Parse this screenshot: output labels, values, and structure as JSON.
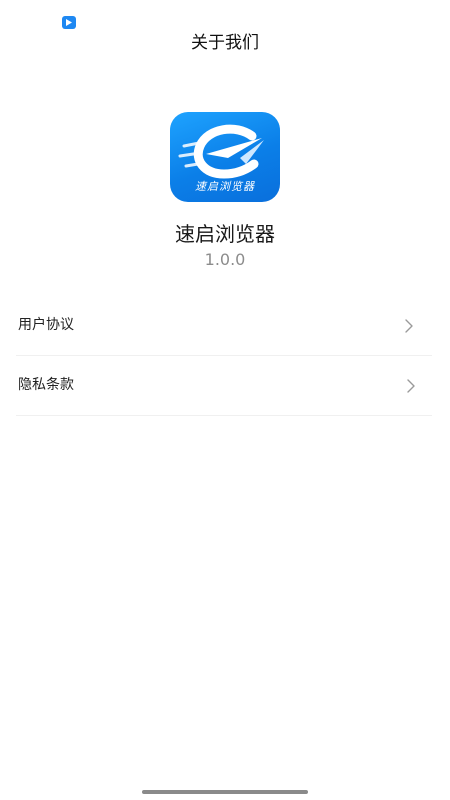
{
  "status_bar": {
    "icon": "app-notification-icon"
  },
  "header": {
    "title": "关于我们"
  },
  "app": {
    "logo_icon": "browser-logo-icon",
    "logo_caption": "速启浏览器",
    "name": "速启浏览器",
    "version": "1.0.0"
  },
  "menu": {
    "items": [
      {
        "label": "用户协议",
        "icon": "chevron-right-icon"
      },
      {
        "label": "隐私条款",
        "icon": "chevron-right-icon"
      }
    ]
  },
  "colors": {
    "brand": "#0b7fe8",
    "text_primary": "#1a1a1a",
    "text_secondary": "#8c8c8c"
  }
}
